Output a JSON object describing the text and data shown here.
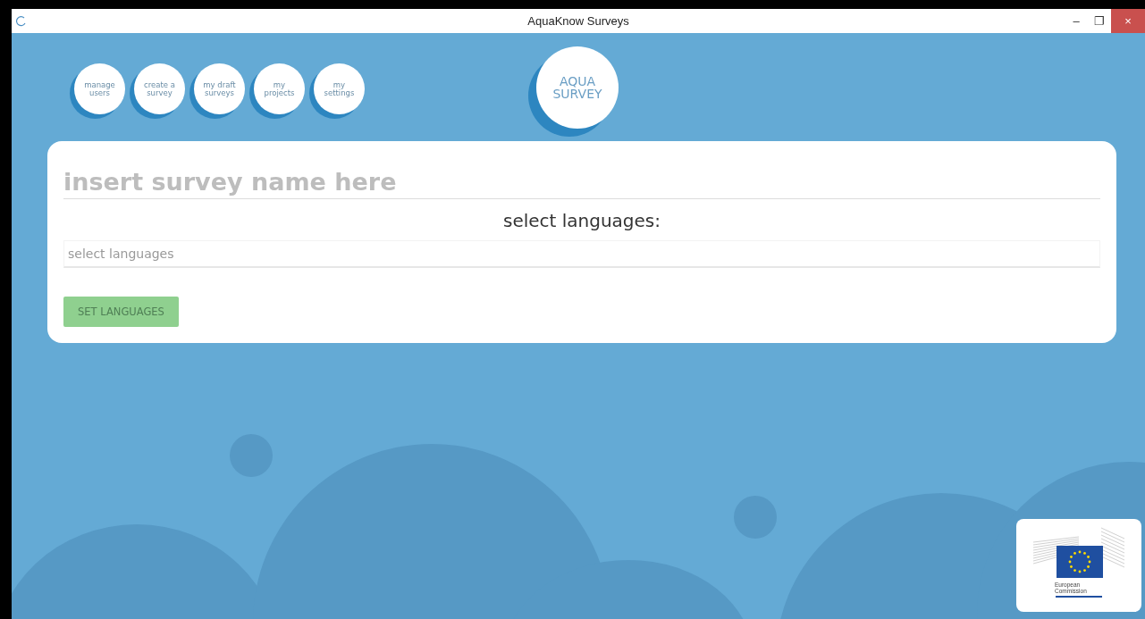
{
  "window": {
    "title": "AquaKnow Surveys",
    "controls": [
      "–",
      "❐",
      "×"
    ]
  },
  "nav": [
    {
      "label": "manage users"
    },
    {
      "label": "create a survey"
    },
    {
      "label": "my draft surveys"
    },
    {
      "label": "my projects"
    },
    {
      "label": "my settings"
    }
  ],
  "logo": {
    "lines": [
      "AQUA",
      "SURVEY"
    ]
  },
  "form": {
    "name_placeholder": "insert survey name here",
    "languages_heading": "select languages:",
    "languages_placeholder": "select languages",
    "button": "SET LANGUAGES"
  },
  "sponsor": {
    "lines": [
      "European",
      "Commission"
    ]
  }
}
